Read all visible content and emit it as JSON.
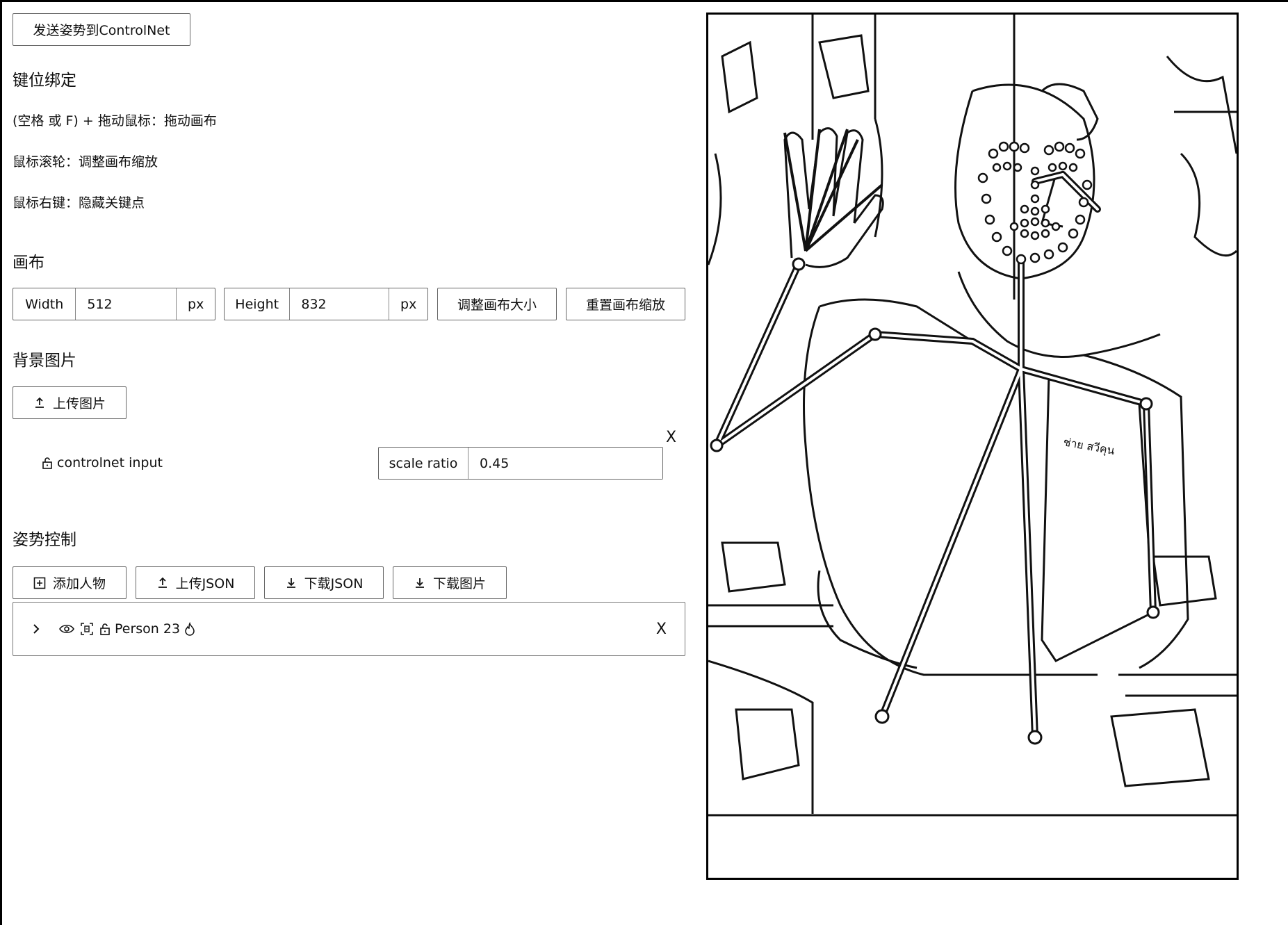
{
  "send_button": {
    "label": "发送姿势到ControlNet"
  },
  "keybindings": {
    "title": "键位绑定",
    "lines": [
      "(空格 或 F) + 拖动鼠标：拖动画布",
      "鼠标滚轮：调整画布缩放",
      "鼠标右键：隐藏关键点"
    ]
  },
  "canvas_section": {
    "title": "画布",
    "width_label": "Width",
    "width_value": "512",
    "width_unit": "px",
    "height_label": "Height",
    "height_value": "832",
    "height_unit": "px",
    "resize_button": "调整画布大小",
    "reset_zoom_button": "重置画布缩放"
  },
  "background_section": {
    "title": "背景图片",
    "upload_button": "上传图片",
    "item_label": "controlnet input",
    "scale_label": "scale ratio",
    "scale_value": "0.45",
    "close_label": "X"
  },
  "pose_section": {
    "title": "姿势控制",
    "add_person_button": "添加人物",
    "upload_json_button": "上传JSON",
    "download_json_button": "下载JSON",
    "download_image_button": "下载图片"
  },
  "person": {
    "name": "Person 23",
    "close_label": "X"
  },
  "preview": {
    "book_text": "ช่าย สวีคุน"
  },
  "colors": {
    "border": "#666666",
    "background": "#ffffff",
    "text": "#111111"
  }
}
